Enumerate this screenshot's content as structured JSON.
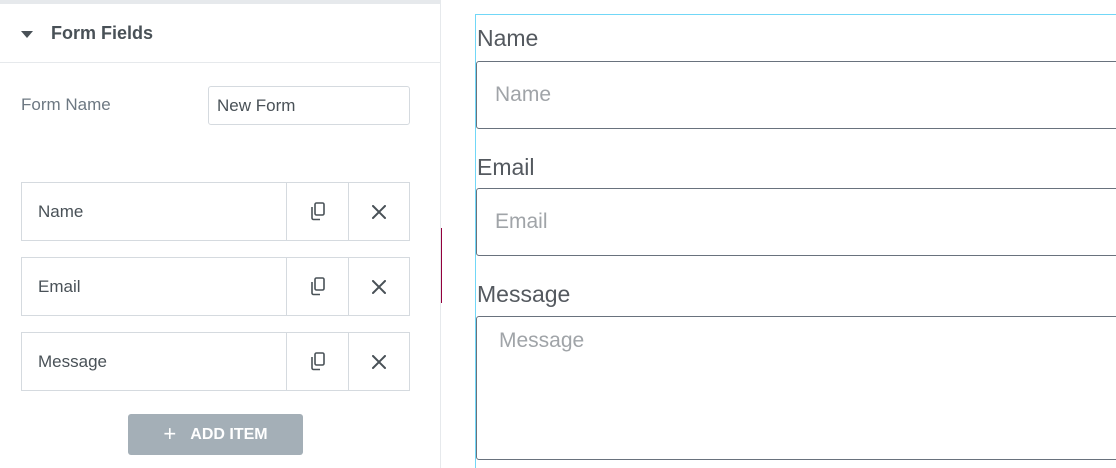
{
  "panel": {
    "section_title": "Form Fields",
    "form_name_label": "Form Name",
    "form_name_value": "New Form",
    "fields": [
      {
        "label": "Name"
      },
      {
        "label": "Email"
      },
      {
        "label": "Message"
      }
    ],
    "add_item_label": "ADD ITEM",
    "add_item_icon": "+"
  },
  "preview": {
    "name_label": "Name",
    "name_placeholder": "Name",
    "email_label": "Email",
    "email_placeholder": "Email",
    "message_label": "Message",
    "message_placeholder": "Message"
  },
  "colors": {
    "toggle_accent": "#93003c",
    "widget_outline": "#71d7f7",
    "button_bg": "#a4afb7"
  }
}
